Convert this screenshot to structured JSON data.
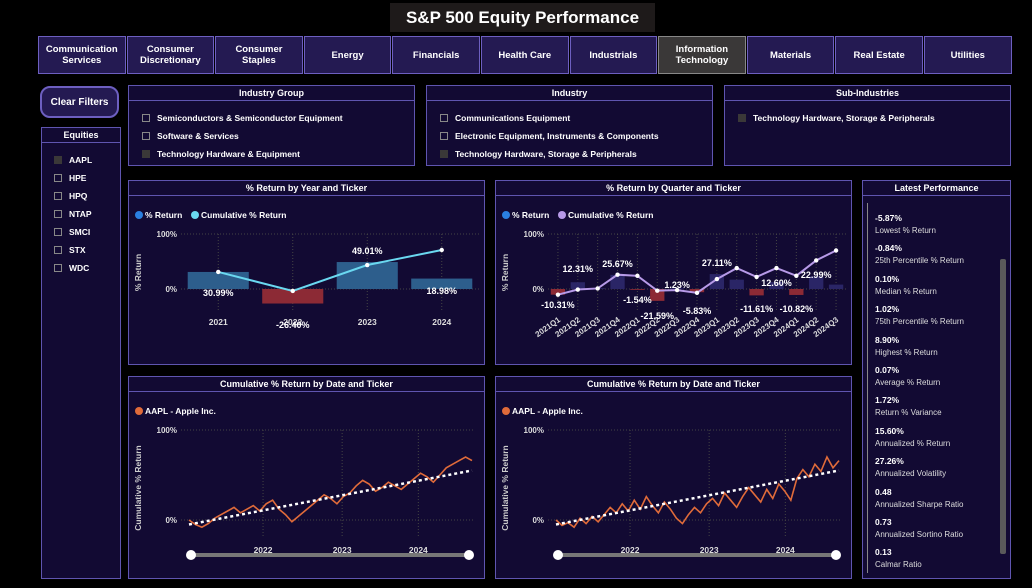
{
  "title": "S&P 500 Equity Performance",
  "sectors": [
    {
      "label": "Communication\nServices"
    },
    {
      "label": "Consumer\nDiscretionary"
    },
    {
      "label": "Consumer\nStaples"
    },
    {
      "label": "Energy"
    },
    {
      "label": "Financials"
    },
    {
      "label": "Health Care"
    },
    {
      "label": "Industrials"
    },
    {
      "label": "Information\nTechnology",
      "active": true
    },
    {
      "label": "Materials"
    },
    {
      "label": "Real Estate"
    },
    {
      "label": "Utilities"
    }
  ],
  "clear_filters": "Clear Filters",
  "equities": {
    "header": "Equities",
    "items": [
      {
        "label": "AAPL",
        "checked": true
      },
      {
        "label": "HPE",
        "checked": false
      },
      {
        "label": "HPQ",
        "checked": false
      },
      {
        "label": "NTAP",
        "checked": false
      },
      {
        "label": "SMCI",
        "checked": false
      },
      {
        "label": "STX",
        "checked": false
      },
      {
        "label": "WDC",
        "checked": false
      }
    ]
  },
  "industry_group": {
    "header": "Industry Group",
    "items": [
      {
        "label": "Semiconductors & Semiconductor Equipment",
        "checked": false
      },
      {
        "label": "Software & Services",
        "checked": false
      },
      {
        "label": "Technology Hardware & Equipment",
        "checked": true
      }
    ]
  },
  "industry": {
    "header": "Industry",
    "items": [
      {
        "label": "Communications Equipment",
        "checked": false
      },
      {
        "label": "Electronic Equipment, Instruments & Components",
        "checked": false
      },
      {
        "label": "Technology Hardware, Storage & Peripherals",
        "checked": true
      }
    ]
  },
  "sub_industries": {
    "header": "Sub-Industries",
    "items": [
      {
        "label": "Technology Hardware, Storage & Peripherals",
        "checked": true
      }
    ]
  },
  "colors": {
    "positive_bar": "#2d5e8c",
    "negative_bar": "#8c2a35",
    "cumulative_year": "#6ad8f0",
    "cumulative_quarter": "#b79ae8",
    "price_line": "#e06b3a",
    "legend_return": "#2a7fe0"
  },
  "chart_data": [
    {
      "type": "bar",
      "title": "% Return by Year and Ticker",
      "ylabel": "% Return",
      "legend": [
        "% Return",
        "Cumulative % Return"
      ],
      "categories": [
        "2021",
        "2022",
        "2023",
        "2024"
      ],
      "series": [
        {
          "name": "% Return",
          "values": [
            30.99,
            -26.4,
            49.01,
            18.98
          ]
        },
        {
          "name": "Cumulative % Return",
          "values": [
            30.99,
            -3.6,
            43.6,
            70.9
          ]
        }
      ],
      "data_labels": [
        "30.99%",
        "-26.40%",
        "49.01%",
        "18.98%"
      ],
      "y_ticks": [
        "100%",
        "0%"
      ],
      "ylim": [
        -40,
        100
      ]
    },
    {
      "type": "bar",
      "title": "% Return by Quarter and Ticker",
      "ylabel": "% Return",
      "legend": [
        "% Return",
        "Cumulative % Return"
      ],
      "categories": [
        "2021Q1",
        "2021Q2",
        "2021Q3",
        "2021Q4",
        "2022Q1",
        "2022Q2",
        "2022Q3",
        "2022Q4",
        "2023Q1",
        "2023Q2",
        "2023Q3",
        "2023Q4",
        "2024Q1",
        "2024Q2",
        "2024Q3"
      ],
      "series": [
        {
          "name": "% Return",
          "values": [
            -10.31,
            12.31,
            1.5,
            25.67,
            -1.54,
            -21.59,
            1.23,
            -5.83,
            27.11,
            17.0,
            -11.61,
            12.6,
            -10.82,
            22.99,
            8.0
          ]
        },
        {
          "name": "Cumulative % Return",
          "values": [
            -10.31,
            -1.0,
            1.0,
            26.0,
            24.0,
            -3.0,
            -2.0,
            -7.0,
            18.0,
            38.0,
            22.0,
            38.0,
            24.0,
            52.0,
            70.0
          ]
        }
      ],
      "data_labels": [
        {
          "i": 0,
          "text": "-10.31%"
        },
        {
          "i": 1,
          "text": "12.31%"
        },
        {
          "i": 3,
          "text": "25.67%"
        },
        {
          "i": 4,
          "text": "-1.54%"
        },
        {
          "i": 5,
          "text": "-21.59%"
        },
        {
          "i": 6,
          "text": "1.23%"
        },
        {
          "i": 7,
          "text": "-5.83%"
        },
        {
          "i": 8,
          "text": "27.11%"
        },
        {
          "i": 10,
          "text": "-11.61%"
        },
        {
          "i": 11,
          "text": "12.60%"
        },
        {
          "i": 12,
          "text": "-10.82%"
        },
        {
          "i": 13,
          "text": "22.99%"
        }
      ],
      "y_ticks": [
        "100%",
        "0%"
      ],
      "ylim": [
        -40,
        100
      ]
    },
    {
      "type": "line",
      "title": "Cumulative % Return by Date and Ticker",
      "ylabel": "Cumulative % Return",
      "legend": [
        "AAPL - Apple Inc."
      ],
      "x_ticks": [
        "2022",
        "2023",
        "2024"
      ],
      "y_ticks": [
        "100%",
        "0%"
      ],
      "ylim": [
        -20,
        100
      ],
      "series": [
        {
          "name": "AAPL - Apple Inc.",
          "values": [
            0,
            -5,
            -8,
            -4,
            2,
            6,
            10,
            14,
            8,
            12,
            16,
            10,
            18,
            22,
            12,
            6,
            -2,
            4,
            10,
            16,
            22,
            28,
            24,
            18,
            26,
            30,
            38,
            44,
            40,
            32,
            36,
            42,
            38,
            34,
            40,
            46,
            52,
            48,
            42,
            50,
            58,
            62,
            66,
            70,
            66
          ]
        }
      ],
      "trend": [
        -5,
        55
      ]
    },
    {
      "type": "line",
      "title": "Cumulative % Return by Date and Ticker",
      "ylabel": "Cumulative % Return",
      "legend": [
        "AAPL - Apple Inc."
      ],
      "x_ticks": [
        "2022",
        "2023",
        "2024"
      ],
      "y_ticks": [
        "100%",
        "0%"
      ],
      "ylim": [
        -20,
        100
      ],
      "series": [
        {
          "name": "AAPL - Apple Inc.",
          "values": [
            0,
            -6,
            -3,
            -8,
            2,
            -4,
            4,
            -2,
            6,
            14,
            8,
            18,
            10,
            22,
            12,
            26,
            16,
            8,
            20,
            12,
            2,
            -4,
            6,
            14,
            8,
            18,
            24,
            16,
            30,
            22,
            14,
            26,
            36,
            28,
            20,
            34,
            24,
            40,
            32,
            22,
            46,
            56,
            48,
            62,
            54,
            70,
            58,
            66
          ]
        }
      ],
      "trend": [
        -5,
        55
      ]
    }
  ],
  "latest": {
    "header": "Latest Performance",
    "items": [
      {
        "value": "-5.87%",
        "label": "Lowest % Return"
      },
      {
        "value": "-0.84%",
        "label": "25th Percentile % Return"
      },
      {
        "value": "0.10%",
        "label": "Median % Return"
      },
      {
        "value": "1.02%",
        "label": "75th Percentile % Return"
      },
      {
        "value": "8.90%",
        "label": "Highest % Return"
      },
      {
        "value": "0.07%",
        "label": "Average % Return"
      },
      {
        "value": "1.72%",
        "label": "Return % Variance"
      },
      {
        "value": "15.60%",
        "label": "Annualized % Return"
      },
      {
        "value": "27.26%",
        "label": "Annualized Volatility"
      },
      {
        "value": "0.48",
        "label": "Annualized Sharpe Ratio"
      },
      {
        "value": "0.73",
        "label": "Annualized Sortino Ratio"
      },
      {
        "value": "0.13",
        "label": "Calmar Ratio"
      }
    ]
  }
}
